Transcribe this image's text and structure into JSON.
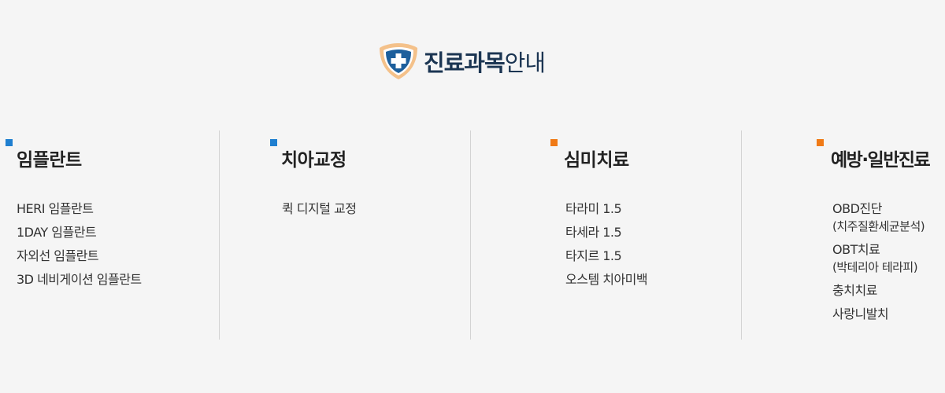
{
  "header": {
    "title_bold": "진료과목",
    "title_light": "안내",
    "icon": "shield-cross-icon"
  },
  "colors": {
    "marker_blue": "#1f7fd0",
    "marker_orange": "#f07a16",
    "title_navy": "#1b3552"
  },
  "columns": [
    {
      "title": "임플란트",
      "marker_color": "#1f7fd0",
      "items": [
        {
          "label": "HERI 임플란트"
        },
        {
          "label": "1DAY 임플란트"
        },
        {
          "label": "자외선 임플란트"
        },
        {
          "label": "3D 네비게이션 임플란트"
        }
      ]
    },
    {
      "title": "치아교정",
      "marker_color": "#1f7fd0",
      "items": [
        {
          "label": "퀵 디지털 교정"
        }
      ]
    },
    {
      "title": "심미치료",
      "marker_color": "#f07a16",
      "items": [
        {
          "label": "타라미 1.5"
        },
        {
          "label": "타세라 1.5"
        },
        {
          "label": "타지르 1.5"
        },
        {
          "label": "오스템 치아미백"
        }
      ]
    },
    {
      "title": "예방·일반진료",
      "marker_color": "#f07a16",
      "items": [
        {
          "label": "OBD진단",
          "sub": "(치주질환세균분석)"
        },
        {
          "label": "OBT치료",
          "sub": "(박테리아 테라피)"
        },
        {
          "label": "충치치료"
        },
        {
          "label": "사랑니발치"
        }
      ]
    }
  ]
}
